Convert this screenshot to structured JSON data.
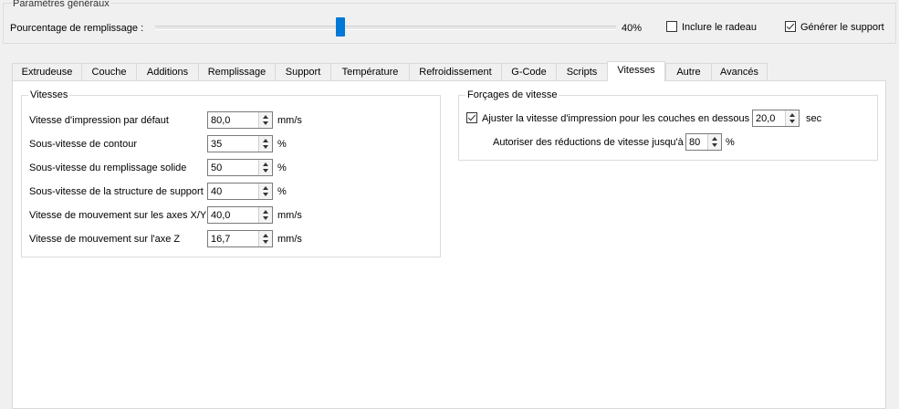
{
  "general": {
    "title": "Paramètres généraux",
    "fill_label": "Pourcentage de remplissage :",
    "fill_percent": 0.4,
    "fill_percent_text": "40%",
    "raft_label": "Inclure le radeau",
    "raft_checked": false,
    "support_label": "Générer le support",
    "support_checked": true,
    "accent_color": "#0078d7"
  },
  "tabs": [
    {
      "label": "Extrudeuse"
    },
    {
      "label": "Couche"
    },
    {
      "label": "Additions"
    },
    {
      "label": "Remplissage"
    },
    {
      "label": "Support"
    },
    {
      "label": "Température"
    },
    {
      "label": "Refroidissement"
    },
    {
      "label": "G-Code"
    },
    {
      "label": "Scripts"
    },
    {
      "label": "Vitesses",
      "active": true
    },
    {
      "label": "Autre"
    },
    {
      "label": "Avancés"
    }
  ],
  "speeds": {
    "title": "Vitesses",
    "rows": [
      {
        "label": "Vitesse d'impression par défaut",
        "value": "80,0",
        "unit": "mm/s"
      },
      {
        "label": "Sous-vitesse de contour",
        "value": "35",
        "unit": "%"
      },
      {
        "label": "Sous-vitesse du remplissage solide",
        "value": "50",
        "unit": "%"
      },
      {
        "label": "Sous-vitesse de la structure de support",
        "value": "40",
        "unit": "%"
      },
      {
        "label": "Vitesse de mouvement sur les axes X/Y",
        "value": "40,0",
        "unit": "mm/s"
      },
      {
        "label": "Vitesse de mouvement sur l'axe Z",
        "value": "16,7",
        "unit": "mm/s"
      }
    ]
  },
  "overrides": {
    "title": "Forçages de vitesse",
    "adjust_label": "Ajuster la vitesse d'impression pour les couches en dessous",
    "adjust_checked": true,
    "adjust_value": "20,0",
    "adjust_unit": "sec",
    "reduce_label": "Autoriser des réductions de vitesse jusqu'à",
    "reduce_value": "80",
    "reduce_unit": "%"
  }
}
